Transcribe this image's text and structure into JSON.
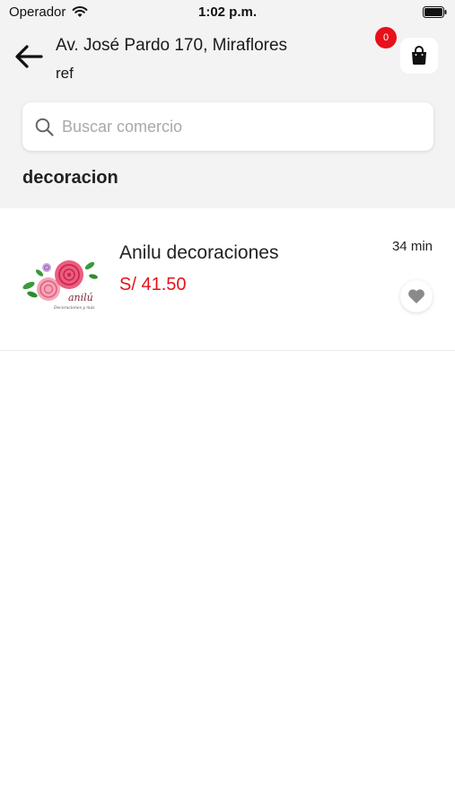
{
  "status_bar": {
    "carrier": "Operador",
    "time": "1:02 p.m."
  },
  "header": {
    "address": "Av. José Pardo 170, Miraflores",
    "reference": "ref",
    "cart_count": "0"
  },
  "search": {
    "placeholder": "Buscar comercio",
    "value": ""
  },
  "category": {
    "title": "decoracion"
  },
  "stores": [
    {
      "name": "Anilu decoraciones",
      "price": "S/ 41.50",
      "eta": "34 min",
      "logo_text": "anilú",
      "logo_subtitle": "Decoraciones y más"
    }
  ],
  "colors": {
    "accent": "#e8101a",
    "background_top": "#f3f3f4",
    "favorite_icon": "#8a8a8a"
  },
  "icons": [
    "wifi-icon",
    "battery-icon",
    "back-arrow-icon",
    "shopping-bag-icon",
    "search-icon",
    "heart-icon"
  ]
}
